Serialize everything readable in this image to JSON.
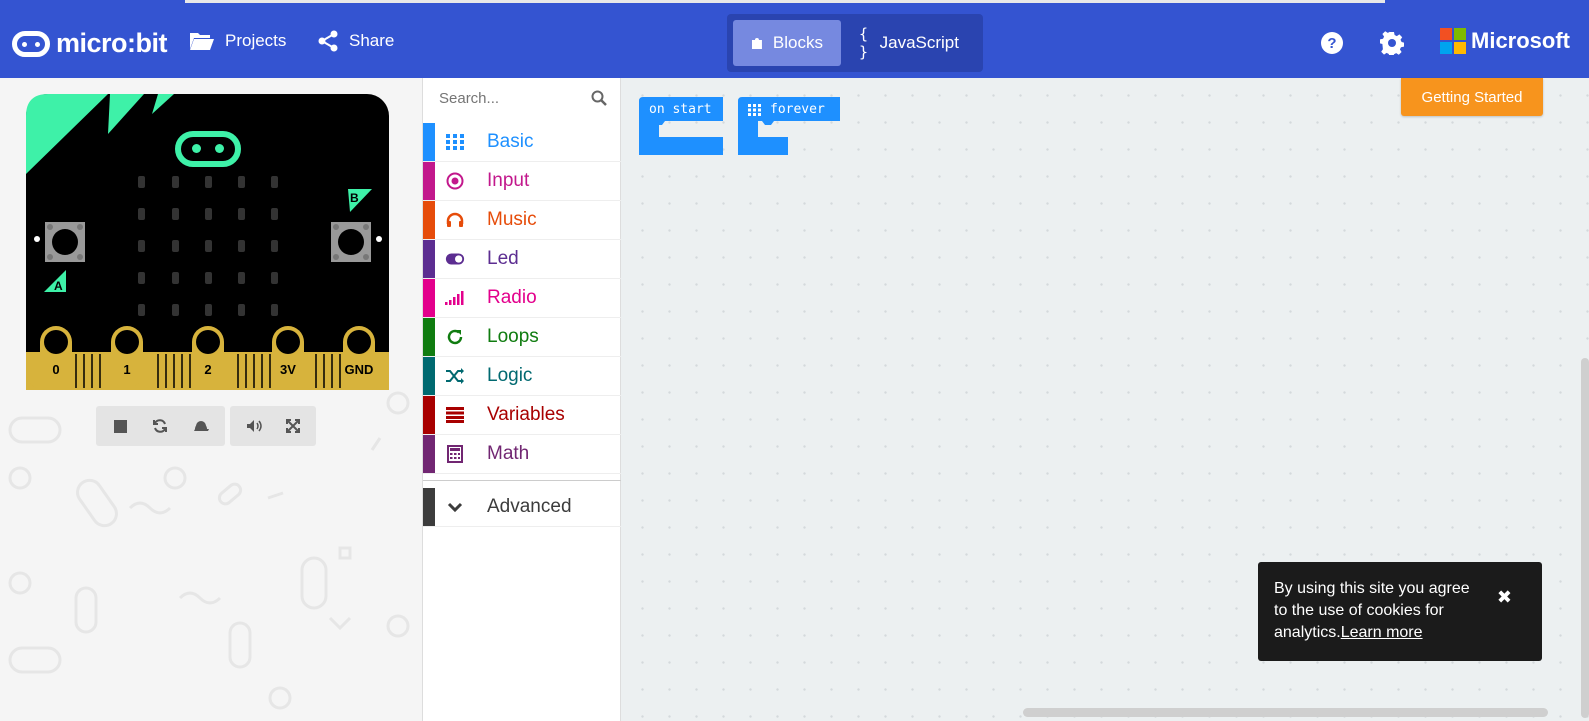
{
  "header": {
    "logo_text": "micro:bit",
    "projects_label": "Projects",
    "share_label": "Share",
    "modes": {
      "blocks_label": "Blocks",
      "javascript_braces": "{ }",
      "javascript_label": "JavaScript"
    },
    "microsoft_label": "Microsoft",
    "colors": {
      "bar": "#3454d1"
    }
  },
  "simulator": {
    "pins": [
      "0",
      "1",
      "2",
      "3V",
      "GND"
    ],
    "button_a": "A",
    "button_b": "B"
  },
  "toolbox": {
    "search_placeholder": "Search...",
    "categories": [
      {
        "label": "Basic",
        "color": "#1e90ff",
        "icon": "grid-icon"
      },
      {
        "label": "Input",
        "color": "#c2188c",
        "icon": "target-icon"
      },
      {
        "label": "Music",
        "color": "#e64c0a",
        "icon": "headphones-icon"
      },
      {
        "label": "Led",
        "color": "#5c2d91",
        "icon": "toggle-icon"
      },
      {
        "label": "Radio",
        "color": "#e3008c",
        "icon": "signal-icon"
      },
      {
        "label": "Loops",
        "color": "#107c10",
        "icon": "refresh-icon"
      },
      {
        "label": "Logic",
        "color": "#006970",
        "icon": "shuffle-icon"
      },
      {
        "label": "Variables",
        "color": "#a80000",
        "icon": "list-icon"
      },
      {
        "label": "Math",
        "color": "#712672",
        "icon": "calculator-icon"
      }
    ],
    "advanced_label": "Advanced"
  },
  "workspace": {
    "blocks": [
      {
        "label": "on start"
      },
      {
        "label": "forever"
      }
    ],
    "getting_started_label": "Getting Started"
  },
  "cookie": {
    "text": "By using this site you agree to the use of cookies for analytics.",
    "link": "Learn more",
    "close": "✖"
  }
}
